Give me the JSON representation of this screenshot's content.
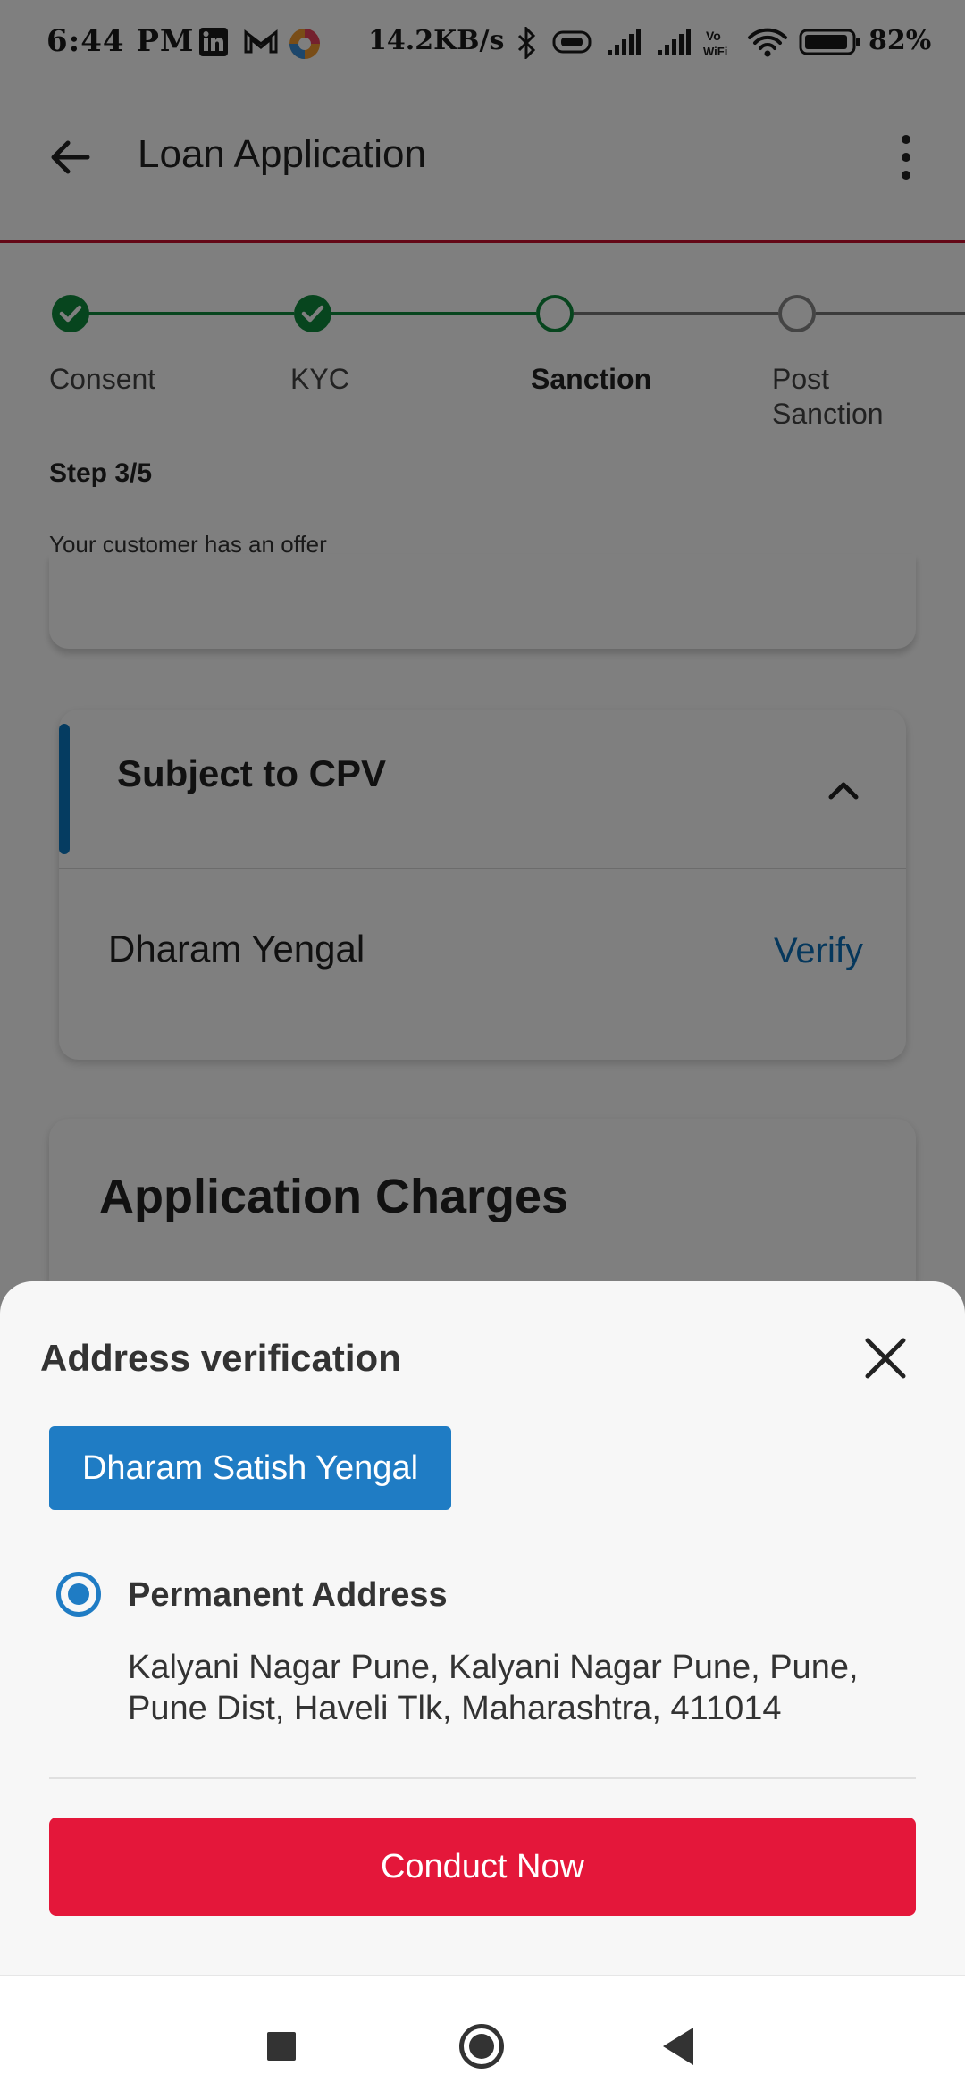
{
  "status_bar": {
    "time": "6:44 PM",
    "network_speed": "14.2KB/s",
    "battery_percent": "82%",
    "icons": [
      "linkedin-icon",
      "gmail-icon",
      "browser-icon",
      "bluetooth-icon",
      "vibrate-icon",
      "signal-icon",
      "signal-icon",
      "vowifi-icon",
      "wifi-icon",
      "battery-icon"
    ]
  },
  "app_bar": {
    "title": "Loan Application",
    "back_icon": "arrow-left-icon",
    "menu_icon": "more-vertical-icon"
  },
  "stepper": {
    "steps": [
      {
        "label": "Consent",
        "state": "done"
      },
      {
        "label": "KYC",
        "state": "done"
      },
      {
        "label": "Sanction",
        "state": "current"
      },
      {
        "label": "Post Sanction",
        "state": "pending"
      }
    ],
    "step_count": "Step 3/5",
    "message": "Your customer has an offer"
  },
  "cpv_card": {
    "title": "Subject to CPV",
    "applicant_name": "Dharam Yengal",
    "verify_label": "Verify",
    "accent_color": "#0a78c2"
  },
  "charges_card": {
    "title": "Application Charges"
  },
  "sheet": {
    "title": "Address verification",
    "applicant_chip": "Dharam Satish Yengal",
    "address_type": "Permanent Address",
    "address": "Kalyani Nagar Pune, Kalyani Nagar Pune, Pune, Pune Dist, Haveli Tlk, Maharashtra, 411014",
    "address_selected": true,
    "primary_button": "Conduct Now"
  },
  "colors": {
    "brand_red": "#e4173a",
    "accent_blue": "#1f7cc4",
    "success_green": "#0f8a3c"
  }
}
